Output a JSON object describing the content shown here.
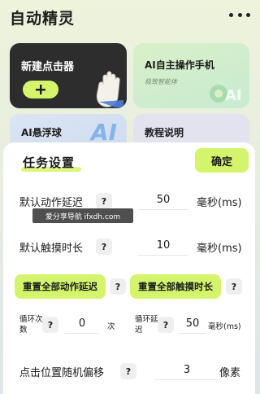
{
  "app": {
    "title": "自动精灵",
    "menu_icon": "more-horizontal-icon"
  },
  "cards": {
    "new_clicker": {
      "label": "新建点击器",
      "button_icon": "plus-icon",
      "decor_icon": "hand-tap-icon"
    },
    "ai_operator": {
      "label": "AI自主操作手机",
      "subtitle": "极致智能体"
    },
    "ai_float": {
      "label": "AI悬浮球",
      "deco_text": "AI"
    },
    "tutorial": {
      "label": "教程说明"
    }
  },
  "sheet": {
    "title": "任务设置",
    "confirm_label": "确定",
    "default_action_delay": {
      "label": "默认动作延迟",
      "value": "50",
      "unit": "毫秒(ms)"
    },
    "default_touch_duration": {
      "label": "默认触摸时长",
      "value": "10",
      "unit": "毫秒(ms)"
    },
    "reset_all_delays_label": "重置全部动作延迟",
    "reset_all_touch_label": "重置全部触摸时长",
    "loop_count": {
      "label": "循环次数",
      "value": "0",
      "unit": "次"
    },
    "loop_delay": {
      "label": "循环延迟",
      "value": "50",
      "unit": "毫秒(ms)"
    },
    "random_offset": {
      "label": "点击位置随机偏移",
      "value": "3",
      "unit": "像素"
    },
    "help_glyph": "?"
  },
  "watermark": "爱分享导航 ifxdh.com",
  "colors": {
    "accent": "#d4f56b",
    "dark_card": "#2d2d2d",
    "ai_blue": "#7fb0e6"
  }
}
